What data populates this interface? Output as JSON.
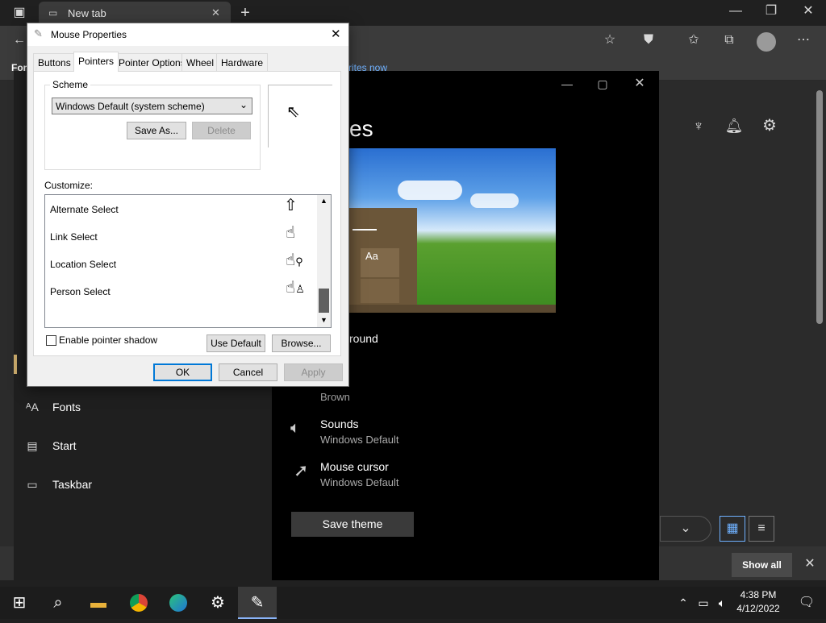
{
  "browser": {
    "tab_title": "New tab",
    "fav_partial": "For",
    "news_partial": "rites now"
  },
  "settings": {
    "header_partial": "es",
    "nav": [
      {
        "icon": "fonts-icon",
        "label": "Fonts"
      },
      {
        "icon": "start-icon",
        "label": "Start"
      },
      {
        "icon": "taskbar-icon",
        "label": "Taskbar"
      }
    ],
    "preview_text": "Aa",
    "background_partial": "round",
    "color_value": "Brown",
    "sounds": {
      "label": "Sounds",
      "value": "Windows Default"
    },
    "mouse_cursor": {
      "label": "Mouse cursor",
      "value": "Windows Default"
    },
    "save_theme": "Save theme",
    "show_all": "Show all"
  },
  "dialog": {
    "title": "Mouse Properties",
    "tabs": [
      "Buttons",
      "Pointers",
      "Pointer Options",
      "Wheel",
      "Hardware"
    ],
    "selected_tab": "Pointers",
    "scheme_label": "Scheme",
    "scheme_value": "Windows Default (system scheme)",
    "save_as": "Save As...",
    "delete": "Delete",
    "customize_label": "Customize:",
    "list": [
      {
        "label": "Alternate Select",
        "cursor": "up-arrow-icon"
      },
      {
        "label": "Link Select",
        "cursor": "hand-icon"
      },
      {
        "label": "Location Select",
        "cursor": "hand-location-icon"
      },
      {
        "label": "Person Select",
        "cursor": "hand-person-icon"
      }
    ],
    "shadow_label": "Enable pointer shadow",
    "use_default": "Use Default",
    "browse": "Browse...",
    "ok": "OK",
    "cancel": "Cancel",
    "apply": "Apply"
  },
  "taskbar": {
    "time": "4:38 PM",
    "date": "4/12/2022"
  }
}
